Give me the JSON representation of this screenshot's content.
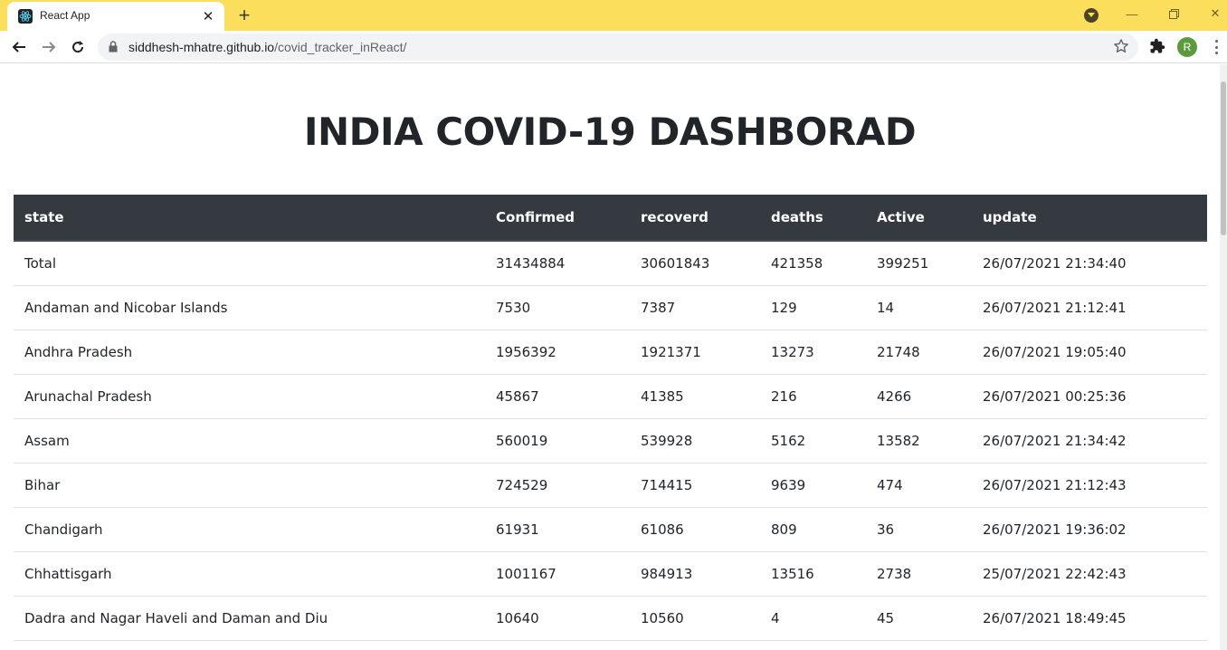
{
  "browser": {
    "tab_title": "React App",
    "url_host": "siddhesh-mhatre.github.io",
    "url_path": "/covid_tracker_inReact/",
    "profile_initial": "R",
    "accent_color": "#fbde5b"
  },
  "page": {
    "title_strong": "INDIA",
    "title_rest": " COVID-19 DASHBORAD"
  },
  "table": {
    "headers": [
      "state",
      "Confirmed",
      "recoverd",
      "deaths",
      "Active",
      "update"
    ],
    "rows": [
      [
        "Total",
        "31434884",
        "30601843",
        "421358",
        "399251",
        "26/07/2021 21:34:40"
      ],
      [
        "Andaman and Nicobar Islands",
        "7530",
        "7387",
        "129",
        "14",
        "26/07/2021 21:12:41"
      ],
      [
        "Andhra Pradesh",
        "1956392",
        "1921371",
        "13273",
        "21748",
        "26/07/2021 19:05:40"
      ],
      [
        "Arunachal Pradesh",
        "45867",
        "41385",
        "216",
        "4266",
        "26/07/2021 00:25:36"
      ],
      [
        "Assam",
        "560019",
        "539928",
        "5162",
        "13582",
        "26/07/2021 21:34:42"
      ],
      [
        "Bihar",
        "724529",
        "714415",
        "9639",
        "474",
        "26/07/2021 21:12:43"
      ],
      [
        "Chandigarh",
        "61931",
        "61086",
        "809",
        "36",
        "26/07/2021 19:36:02"
      ],
      [
        "Chhattisgarh",
        "1001167",
        "984913",
        "13516",
        "2738",
        "25/07/2021 22:42:43"
      ],
      [
        "Dadra and Nagar Haveli and Daman and Diu",
        "10640",
        "10560",
        "4",
        "45",
        "26/07/2021 18:49:45"
      ]
    ]
  }
}
